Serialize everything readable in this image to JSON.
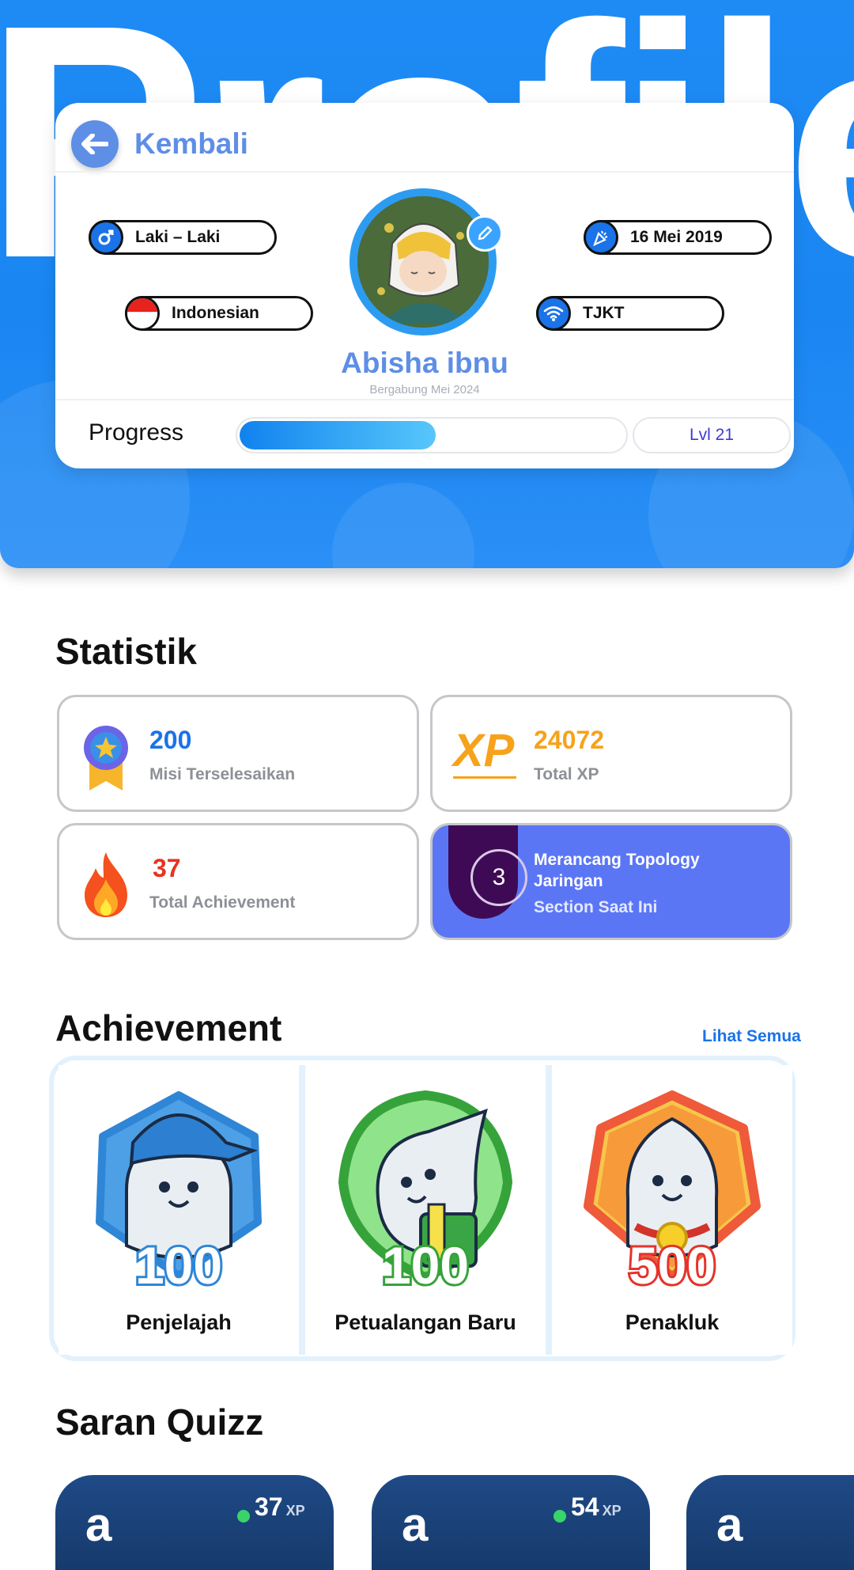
{
  "hero": {
    "background_word": "Profile"
  },
  "header": {
    "back_label": "Kembali"
  },
  "profile": {
    "gender": "Laki – Laki",
    "nationality": "Indonesian",
    "birthdate": "16 Mei 2019",
    "major": "TJKT",
    "name": "Abisha ibnu",
    "joined": "Bergabung Mei 2024"
  },
  "progress": {
    "label": "Progress",
    "level": "Lvl 21",
    "fraction": 0.51
  },
  "statistik": {
    "title": "Statistik",
    "missions": {
      "value": "200",
      "label": "Misi Terselesaikan"
    },
    "xp": {
      "value": "24072",
      "label": "Total XP",
      "icon_text": "XP"
    },
    "achievements": {
      "value": "37",
      "label": "Total Achievement"
    },
    "current_section": {
      "number": "3",
      "title": "Merancang Topology Jaringan",
      "label": "Section Saat Ini"
    }
  },
  "achievement": {
    "title": "Achievement",
    "see_all": "Lihat Semua",
    "items": [
      {
        "name": "Penjelajah",
        "badge_number": "100",
        "color": "#2f86d6"
      },
      {
        "name": "Petualangan Baru",
        "badge_number": "100",
        "color": "#36a33a"
      },
      {
        "name": "Penakluk",
        "badge_number": "500",
        "color": "#ee5a3a"
      }
    ]
  },
  "quiz": {
    "title": "Saran Quizz",
    "items": [
      {
        "letter": "a",
        "xp": "37",
        "unit": "XP"
      },
      {
        "letter": "a",
        "xp": "54",
        "unit": "XP"
      },
      {
        "letter": "a",
        "xp": "",
        "unit": ""
      }
    ]
  },
  "colors": {
    "primary": "#1a86f2",
    "accent": "#5e8ee6",
    "section_card": "#5b76f5",
    "xp_orange": "#f7a21b",
    "fire_red": "#e8321f"
  }
}
